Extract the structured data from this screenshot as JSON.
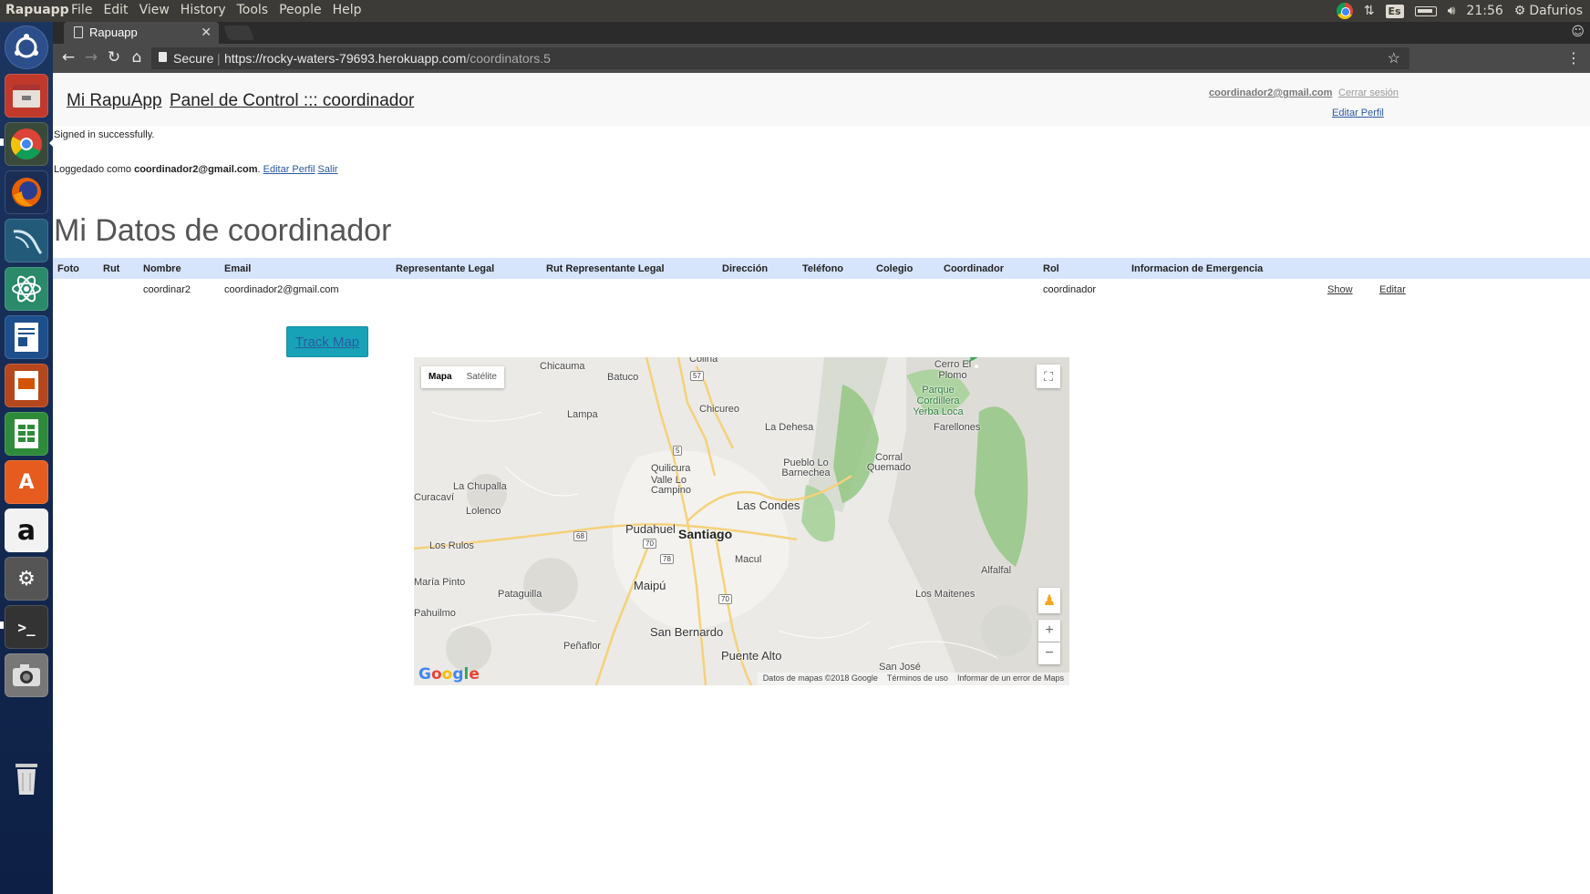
{
  "os": {
    "active_app": "Rapuapp",
    "menus": [
      "File",
      "Edit",
      "View",
      "History",
      "Tools",
      "People",
      "Help"
    ],
    "keyboard_layout": "Es",
    "clock": "21:56",
    "user": "Dafurios"
  },
  "launcher": {
    "items": [
      "ubuntu-dash",
      "files",
      "chrome",
      "firefox",
      "mysql-workbench",
      "atom",
      "libreoffice-writer",
      "libreoffice-impress",
      "libreoffice-calc",
      "software-center",
      "amazon",
      "system-settings",
      "terminal",
      "screenshot",
      "trash"
    ]
  },
  "browser": {
    "tab_title": "Rapuapp",
    "secure_label": "Secure",
    "url_host": "https://rocky-waters-79693.herokuapp.com",
    "url_path": "/coordinators.5"
  },
  "header": {
    "brand": "Mi RapuApp",
    "panel_link": "Panel de Control ::: coordinador",
    "email": "coordinador2@gmail.com",
    "logout": "Cerrar sesión",
    "edit_profile": "Editar Perfil"
  },
  "flash": "Signed in successfully.",
  "login_line": {
    "prefix": "Loggedado como",
    "email": "coordinador2@gmail.com",
    "punct": ".",
    "edit": "Editar Perfil",
    "logout": "Salir"
  },
  "heading": "Mi Datos de coordinador",
  "table": {
    "headers": [
      "Foto",
      "Rut",
      "Nombre",
      "Email",
      "Representante Legal",
      "Rut Representante Legal",
      "Dirección",
      "Teléfono",
      "Colegio",
      "Coordinador",
      "Rol",
      "Informacion de Emergencia",
      "",
      ""
    ],
    "row": [
      "",
      "",
      "coordinar2",
      "coordinador2@gmail.com",
      "",
      "",
      "",
      "",
      "",
      "",
      "coordinador",
      "",
      "Show",
      "Editar"
    ]
  },
  "track_button": "Track Map",
  "map": {
    "type_map": "Mapa",
    "type_satellite": "Satélite",
    "footer_data": "Datos de mapas ©2018 Google",
    "footer_terms": "Términos de uso",
    "footer_report": "Informar de un error de Maps",
    "zoom_in": "+",
    "zoom_out": "−",
    "places": {
      "chicauma": "Chicauma",
      "colina": "Colina",
      "batuco": "Batuco",
      "lampa": "Lampa",
      "chicureo": "Chicureo",
      "la_dehesa": "La Dehesa",
      "cerro_el_plomo": "Cerro El Plomo",
      "parque": "Parque Cordillera Yerba Loca",
      "farellones": "Farellones",
      "corral_quemado": "Corral Quemado",
      "pueblo_lo_barnechea": "Pueblo Lo Barnechea",
      "quilicura": "Quilicura",
      "valle_lo_campino": "Valle Lo Campino",
      "la_chupalla": "La Chupalla",
      "curacavi": "Curacaví",
      "lolenco": "Lolenco",
      "las_condes": "Las Condes",
      "pudahuel": "Pudahuel",
      "santiago": "Santiago",
      "macul": "Macul",
      "los_rulos": "Los Rulos",
      "maria_pinto": "María Pinto",
      "pataguilla": "Pataguilla",
      "maipu": "Maipú",
      "alfalfal": "Alfalfal",
      "los_maitenes": "Los Maitenes",
      "pahuilmo": "Pahuilmo",
      "san_bernardo": "San Bernardo",
      "penaflor": "Peñaflor",
      "puente_alto": "Puente Alto",
      "san_jose": "San José"
    },
    "shields": {
      "r57": "57",
      "r5": "5",
      "r68": "68",
      "r70a": "70",
      "r78": "78",
      "r70b": "70"
    }
  }
}
